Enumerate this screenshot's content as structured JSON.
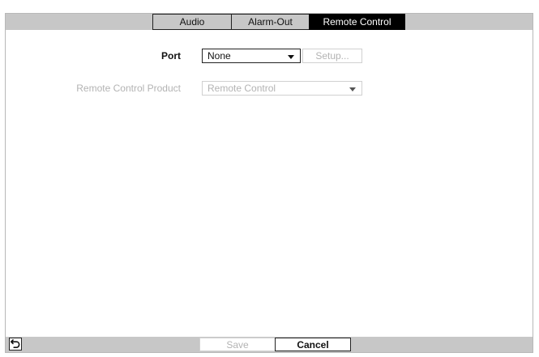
{
  "tabs": [
    {
      "label": "Audio",
      "selected": false
    },
    {
      "label": "Alarm-Out",
      "selected": false
    },
    {
      "label": "Remote Control",
      "selected": true
    }
  ],
  "form": {
    "port": {
      "label": "Port",
      "value": "None",
      "setup_label": "Setup..."
    },
    "product": {
      "label": "Remote Control Product",
      "value": "Remote Control"
    }
  },
  "footer": {
    "back_icon": "back-arrow-icon",
    "save_label": "Save",
    "cancel_label": "Cancel"
  },
  "colors": {
    "bar": "#c7c7c7",
    "selected_tab": "#000000",
    "disabled_text": "#b3b3b3"
  }
}
